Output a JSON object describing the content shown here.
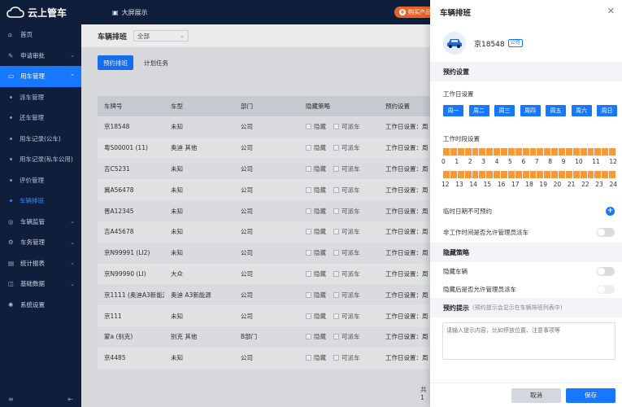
{
  "app": {
    "name": "云上管车",
    "big_screen": "大屏展示",
    "buy_label": "购买产品"
  },
  "sidebar": {
    "items": [
      {
        "label": "首页",
        "icon": "home-icon"
      },
      {
        "label": "申请审批",
        "icon": "approval-icon",
        "chev": "⌄"
      },
      {
        "label": "用车管理",
        "icon": "car-icon",
        "chev": "⌃",
        "active": true
      },
      {
        "label": "车辆监管",
        "icon": "monitor-icon",
        "chev": "⌄"
      },
      {
        "label": "车务管理",
        "icon": "service-icon",
        "chev": "⌄"
      },
      {
        "label": "统计报表",
        "icon": "report-icon",
        "chev": "⌄"
      },
      {
        "label": "基础数据",
        "icon": "data-icon",
        "chev": "⌄"
      },
      {
        "label": "系统设置",
        "icon": "settings-icon",
        "chev": ""
      }
    ],
    "sub_items": [
      "派车管理",
      "还车管理",
      "用车记录(公车)",
      "用车记录(私车公用)",
      "评价管理",
      "车辆排班"
    ]
  },
  "main": {
    "title": "车辆排班",
    "org_select": "全部",
    "tabs": [
      "预约排班",
      "计划任务"
    ],
    "columns": [
      "车牌号",
      "车型",
      "部门",
      "隐藏策略",
      "预约设置"
    ],
    "check_hide": "隐藏",
    "check_dispatch": "可派车",
    "rows": [
      {
        "plate": "京18548",
        "model": "未知",
        "dept": "公司",
        "setting": "工作日设置：周"
      },
      {
        "plate": "粤S00001 (11)",
        "model": "奥迪 其他",
        "dept": "公司",
        "setting": "工作日设置：周"
      },
      {
        "plate": "吉C5231",
        "model": "未知",
        "dept": "公司",
        "setting": "工作日设置：周"
      },
      {
        "plate": "冀A56478",
        "model": "未知",
        "dept": "公司",
        "setting": "工作日设置：周"
      },
      {
        "plate": "晋A12345",
        "model": "未知",
        "dept": "公司",
        "setting": "工作日设置：周"
      },
      {
        "plate": "吉A45678",
        "model": "未知",
        "dept": "公司",
        "setting": "工作日设置：周"
      },
      {
        "plate": "京N99991 (LI2)",
        "model": "未知",
        "dept": "公司",
        "setting": "工作日设置：周"
      },
      {
        "plate": "京N99990 (LI)",
        "model": "大众",
        "dept": "公司",
        "setting": "工作日设置：周"
      },
      {
        "plate": "京1111 (奥迪A3新能源)",
        "model": "奥迪 A3新能源",
        "dept": "公司",
        "setting": "工作日设置：周"
      },
      {
        "plate": "京111",
        "model": "未知",
        "dept": "公司",
        "setting": "工作日设置：周"
      },
      {
        "plate": "蒙a (别克)",
        "model": "别克 其他",
        "dept": "B部门",
        "setting": "工作日设置：周"
      },
      {
        "plate": "京4485",
        "model": "未知",
        "dept": "公司",
        "setting": "工作日设置：周"
      }
    ],
    "pager_text": "共 1"
  },
  "drawer": {
    "title": "车辆排班",
    "plate": "京18548",
    "org_tag": "公司",
    "section_booking": "预约设置",
    "workday_label": "工作日设置",
    "days": [
      "周一",
      "周二",
      "周三",
      "周四",
      "周五",
      "周六",
      "周日"
    ],
    "worktime_label": "工作时段设置",
    "hours_am": [
      "0",
      "1",
      "2",
      "3",
      "4",
      "5",
      "6",
      "7",
      "8",
      "9",
      "10",
      "11",
      "12"
    ],
    "hours_pm": [
      "12",
      "13",
      "14",
      "15",
      "16",
      "17",
      "18",
      "19",
      "20",
      "21",
      "22",
      "23",
      "24"
    ],
    "temp_unavailable": "临时日期不可预约",
    "allow_offhours": "非工作时间是否允许管理员派车",
    "section_hide": "隐藏策略",
    "hide_vehicle": "隐藏车辆",
    "hide_allow": "隐藏后是否允许管理员派车",
    "section_tip": "预约提示",
    "tip_hint": "(预约提示会显示在车辆排班列表中)",
    "tip_placeholder": "请输入提示内容，比如停放位置、注意事项等",
    "cancel": "取消",
    "save": "保存"
  },
  "colors": {
    "primary": "#1677ff",
    "sidebar": "#0f1e3a",
    "slot": "#f59a3c",
    "buy": "#e8632a"
  }
}
